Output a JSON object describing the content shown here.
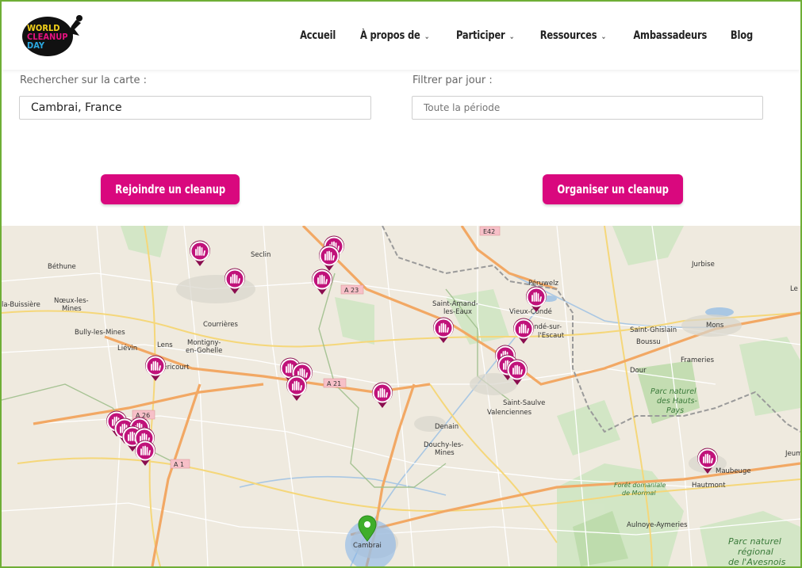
{
  "logo": {
    "text_lines": [
      "WORLD",
      "CLEANUP",
      "DAY"
    ]
  },
  "nav": [
    {
      "label": "Accueil",
      "dropdown": false
    },
    {
      "label": "À propos de",
      "dropdown": true
    },
    {
      "label": "Participer",
      "dropdown": true
    },
    {
      "label": "Ressources",
      "dropdown": true
    },
    {
      "label": "Ambassadeurs",
      "dropdown": false
    },
    {
      "label": "Blog",
      "dropdown": false
    }
  ],
  "search": {
    "label": "Rechercher sur la carte :",
    "value": "Cambrai, France"
  },
  "filter": {
    "label": "Filtrer par jour :",
    "placeholder": "Toute la période"
  },
  "buttons": {
    "join": "Rejoindre un cleanup",
    "organize": "Organiser un cleanup"
  },
  "colors": {
    "accent": "#d9087e",
    "border": "#6fae36",
    "marker_active": "#3fae2a"
  },
  "map": {
    "places": [
      "Béthune",
      "Seclin",
      "Péruwelz",
      "Jurbise",
      "Le",
      "la-Buissière",
      "Nœux-les-",
      "Mines",
      "Bully-les-Mines",
      "Courrières",
      "Montigny-",
      "en-Gohelle",
      "Liévin",
      "Lens",
      "Méricourt",
      "Saint-Amand-",
      "les-Eaux",
      "Vieux-Condé",
      "Condé-sur-",
      "l'Escaut",
      "Saint-Ghislain",
      "Boussu",
      "Mons",
      "Dour",
      "Frameries",
      "Saint-Saulve",
      "Valenciennes",
      "Denain",
      "Douchy-les-",
      "Mines",
      "Maubeuge",
      "Hautmont",
      "Aulnoye-Aymeries",
      "Cambrai",
      "Jeum"
    ],
    "roads": [
      "E42",
      "A 23",
      "A 21",
      "A 26",
      "A 1"
    ],
    "parks": [
      "Parc naturel",
      "des Hauts-",
      "Pays",
      "Forêt domaniale",
      "de Mormal",
      "Parc naturel",
      "régional",
      "de l'Avesnois"
    ]
  }
}
